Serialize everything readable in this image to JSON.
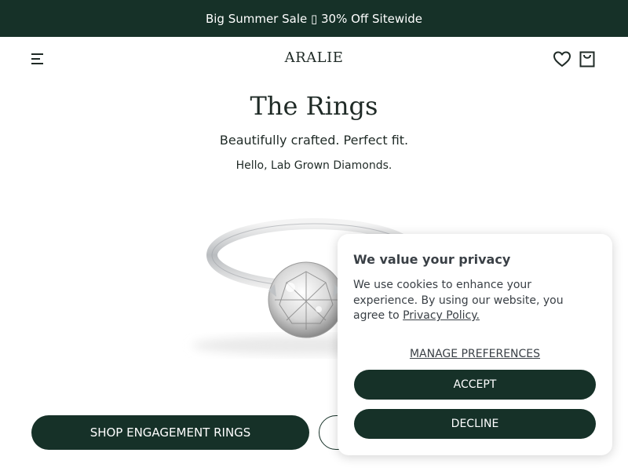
{
  "promo": {
    "text": "Big Summer Sale ▯ 30% Off Sitewide"
  },
  "header": {
    "logo": "ARALIE",
    "icons": [
      "menu-icon",
      "heart-icon",
      "shopping-bag-icon"
    ]
  },
  "hero": {
    "title": "The Rings",
    "subtitle": "Beautifully crafted. Perfect fit.",
    "tagline": "Hello, Lab Grown Diamonds.",
    "image": "solitaire-ring-image"
  },
  "cta": {
    "primary_label": "SHOP ENGAGEMENT RINGS",
    "secondary_label": ""
  },
  "cookie_modal": {
    "title": "We value your privacy",
    "body_text": "We use cookies to enhance your experience. By using our website, you agree to ",
    "privacy_link": "Privacy Policy.",
    "manage_label": "MANAGE PREFERENCES",
    "accept_label": "ACCEPT",
    "decline_label": "DECLINE"
  },
  "colors": {
    "brand_dark_green": "#163128",
    "text_dark": "#1f2a26",
    "modal_text": "#3a4046",
    "background": "#ffffff"
  }
}
